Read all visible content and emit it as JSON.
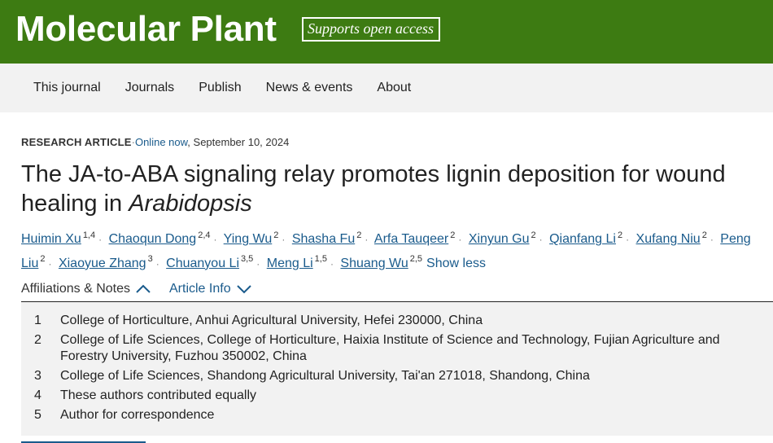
{
  "header": {
    "brand": "Molecular Plant",
    "open_access_badge": "Supports open access",
    "background_color": "#3d7b12"
  },
  "nav": {
    "items": [
      "This journal",
      "Journals",
      "Publish",
      "News & events",
      "About"
    ]
  },
  "article": {
    "type_label": "RESEARCH ARTICLE",
    "separator": "·",
    "status": "Online now",
    "date": ", September 10, 2024",
    "title_main": "The JA-to-ABA signaling relay promotes lignin deposition for wound healing in ",
    "title_italic": "Arabidopsis",
    "authors": [
      {
        "name": "Huimin Xu",
        "sup": "1,4"
      },
      {
        "name": "Chaoqun Dong",
        "sup": "2,4"
      },
      {
        "name": "Ying Wu",
        "sup": "2"
      },
      {
        "name": "Shasha Fu",
        "sup": "2"
      },
      {
        "name": "Arfa Tauqeer",
        "sup": "2"
      },
      {
        "name": "Xinyun Gu",
        "sup": "2"
      },
      {
        "name": "Qianfang Li",
        "sup": "2"
      },
      {
        "name": "Xufang Niu",
        "sup": "2"
      },
      {
        "name": "Peng Liu",
        "sup": "2"
      },
      {
        "name": "Xiaoyue Zhang",
        "sup": "3"
      },
      {
        "name": "Chuanyou Li",
        "sup": "3,5"
      },
      {
        "name": "Meng Li",
        "sup": "1,5"
      },
      {
        "name": "Shuang Wu",
        "sup": "2,5"
      }
    ],
    "show_less": "Show less",
    "link_color": "#1a5b8c"
  },
  "tabs": {
    "affiliations": "Affiliations & Notes",
    "article_info": "Article Info"
  },
  "affiliations": [
    {
      "num": "1",
      "text": "College of Horticulture, Anhui Agricultural University, Hefei 230000, China"
    },
    {
      "num": "2",
      "text": "College of Life Sciences, College of Horticulture, Haixia Institute of Science and Technology, Fujian Agriculture and Forestry University, Fuzhou 350002, China"
    },
    {
      "num": "3",
      "text": "College of Life Sciences, Shandong Agricultural University, Tai'an 271018, Shandong, China"
    },
    {
      "num": "4",
      "text": "These authors contributed equally"
    },
    {
      "num": "5",
      "text": "Author for correspondence"
    }
  ]
}
